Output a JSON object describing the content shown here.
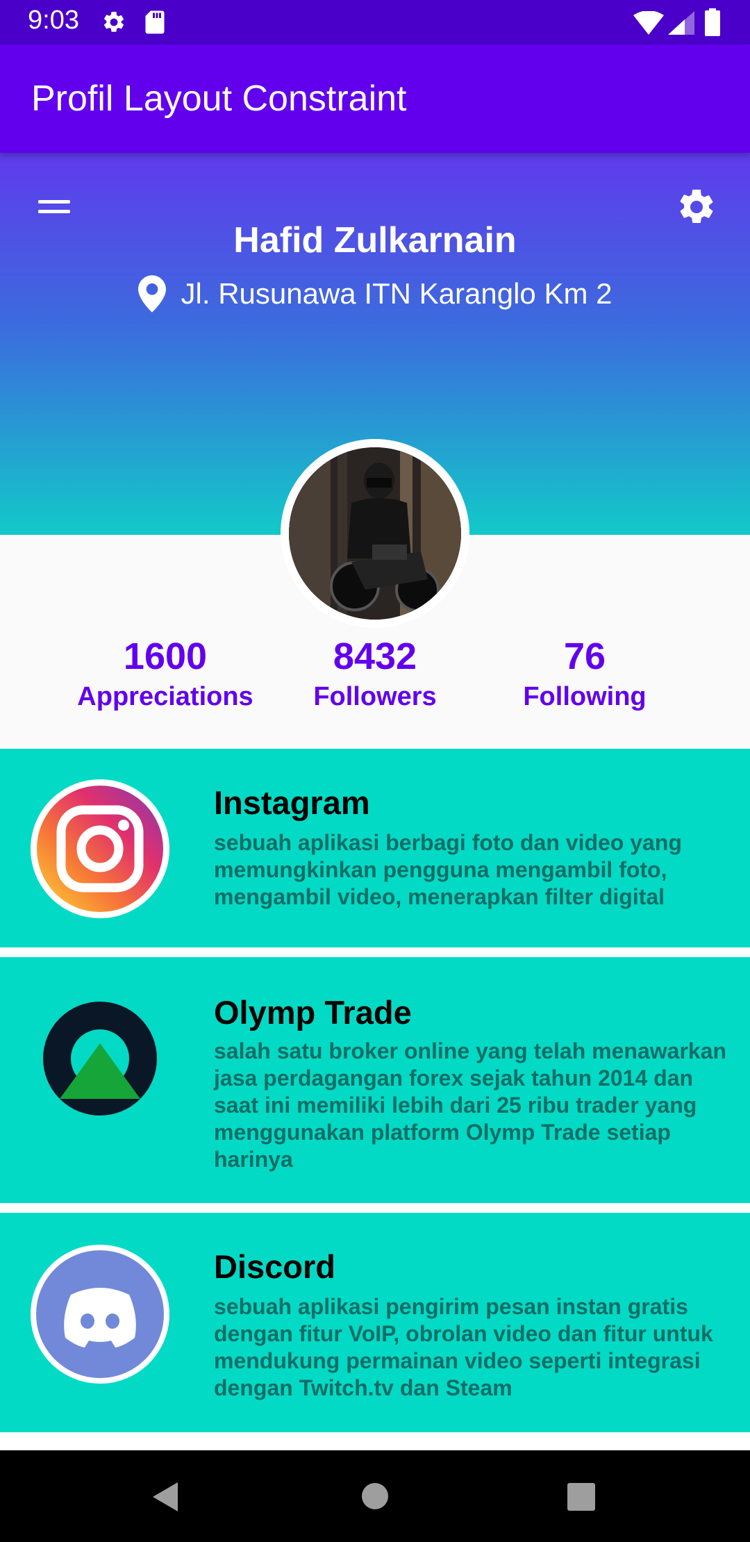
{
  "status_bar": {
    "time": "9:03"
  },
  "app_bar": {
    "title": "Profil Layout Constraint"
  },
  "profile": {
    "name": "Hafid Zulkarnain",
    "location": "Jl. Rusunawa ITN Karanglo Km 2"
  },
  "stats": [
    {
      "value": "1600",
      "label": "Appreciations"
    },
    {
      "value": "8432",
      "label": "Followers"
    },
    {
      "value": "76",
      "label": "Following"
    }
  ],
  "cards": [
    {
      "title": "Instagram",
      "icon": "instagram-icon",
      "description": "sebuah aplikasi berbagi foto dan video yang memungkinkan pengguna mengambil foto, mengambil video, menerapkan filter digital"
    },
    {
      "title": "Olymp Trade",
      "icon": "olymp-trade-icon",
      "description": "salah satu broker online yang telah menawarkan jasa perdagangan forex sejak tahun 2014 dan saat ini memiliki lebih dari 25 ribu trader yang menggunakan platform Olymp Trade setiap harinya"
    },
    {
      "title": "Discord",
      "icon": "discord-icon",
      "description": "sebuah aplikasi pengirim pesan instan gratis dengan fitur VoIP, obrolan video dan fitur untuk mendukung permainan video seperti integrasi dengan Twitch.tv dan Steam"
    }
  ],
  "colors": {
    "primary": "#6200ee",
    "status_bar": "#4a00c8",
    "accent": "#03dac5",
    "description_text": "#0f6e66"
  }
}
